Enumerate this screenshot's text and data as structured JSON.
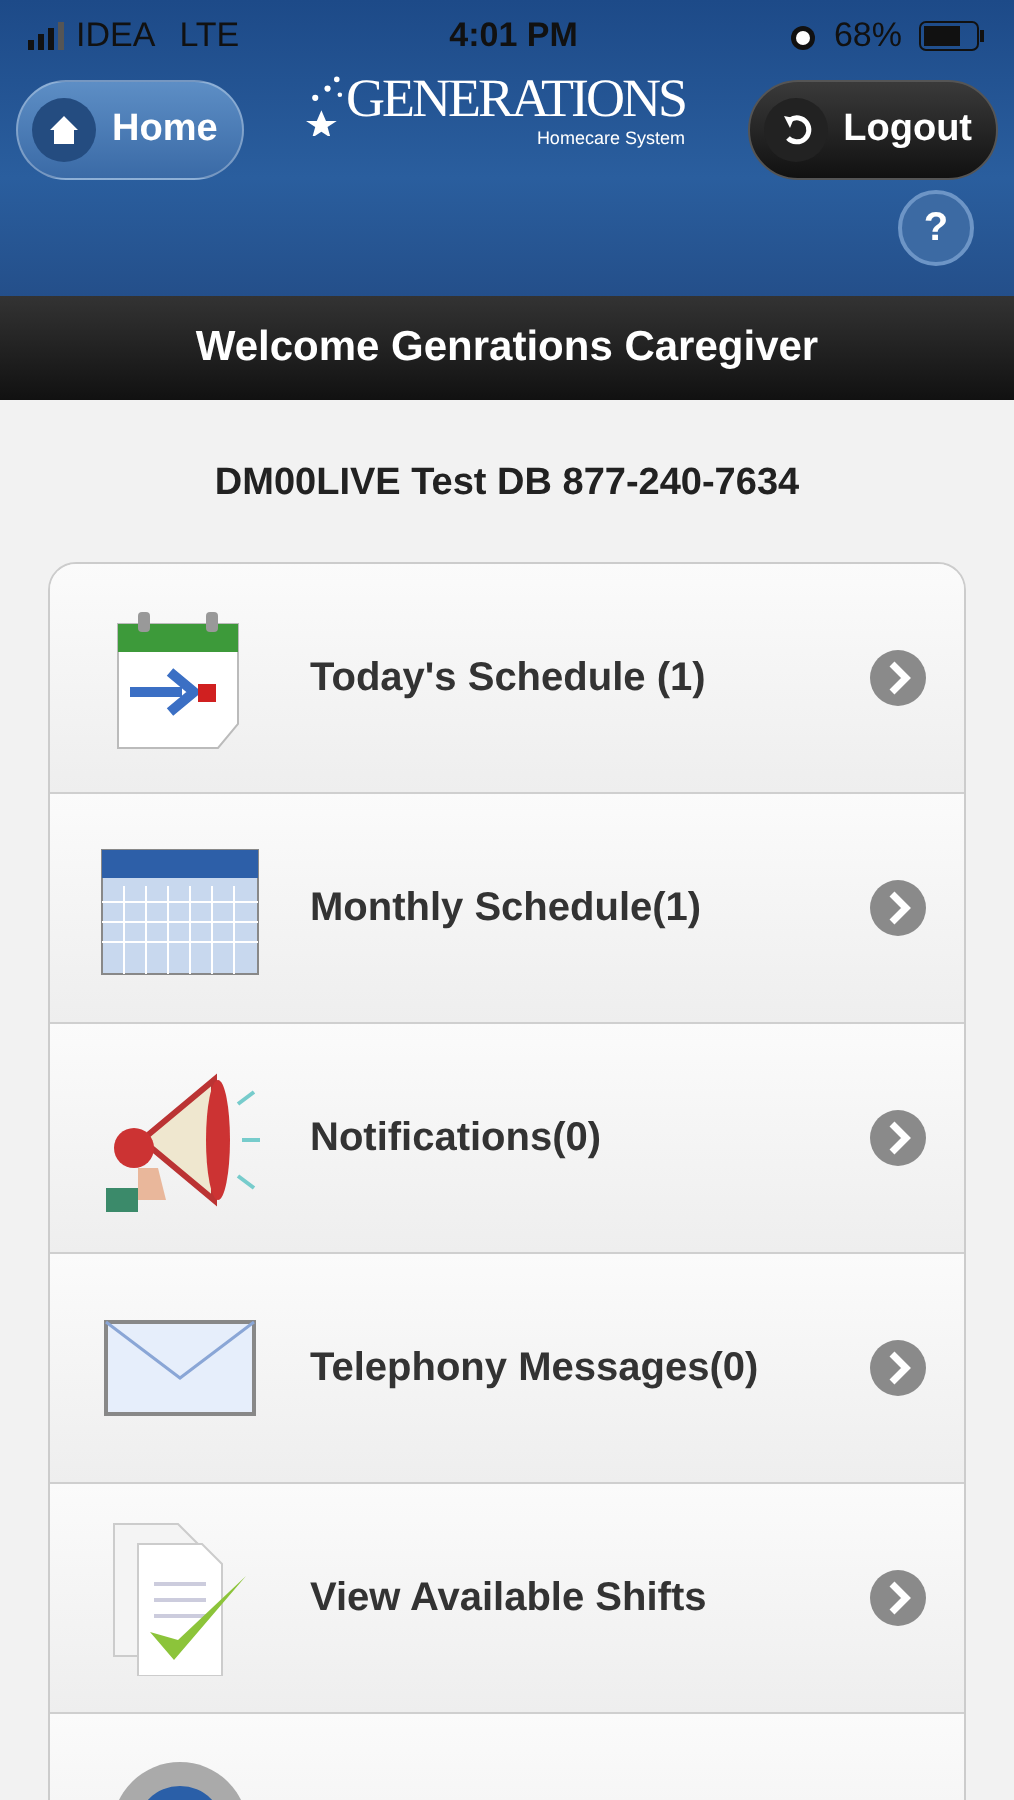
{
  "status_bar": {
    "carrier": "IDEA",
    "network": "LTE",
    "time": "4:01 PM",
    "battery": "68%"
  },
  "header": {
    "home_button": "Home",
    "logo": "GENERATIONS",
    "logo_subtitle": "Homecare System",
    "logout_button": "Logout",
    "help_button": "?"
  },
  "welcome": "Welcome Genrations Caregiver",
  "agency": "DM00LIVE Test DB 877-240-7634",
  "menu": [
    {
      "kind": "today",
      "label": "Today's Schedule (1)"
    },
    {
      "kind": "monthly",
      "label": "Monthly Schedule(1)"
    },
    {
      "kind": "notifications",
      "label": "Notifications(0)"
    },
    {
      "kind": "messages",
      "label": "Telephony Messages(0)"
    },
    {
      "kind": "shifts",
      "label": "View Available Shifts"
    },
    {
      "kind": "settings"
    }
  ]
}
